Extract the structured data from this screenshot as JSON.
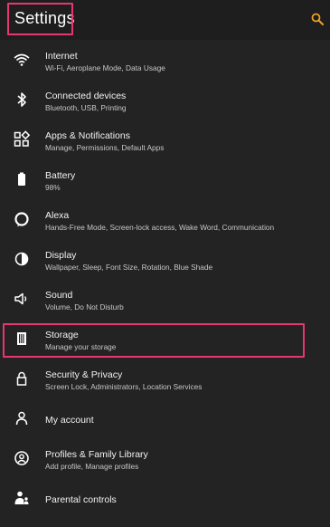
{
  "header": {
    "title": "Settings",
    "search_icon": "search-icon",
    "accent_color": "#f0a024",
    "highlight_color": "#e8366f"
  },
  "settings": [
    {
      "icon": "wifi-icon",
      "label": "Internet",
      "sub": "Wi-Fi, Aeroplane Mode, Data Usage"
    },
    {
      "icon": "bluetooth-icon",
      "label": "Connected devices",
      "sub": "Bluetooth, USB, Printing"
    },
    {
      "icon": "apps-grid-icon",
      "label": "Apps & Notifications",
      "sub": "Manage, Permissions, Default Apps"
    },
    {
      "icon": "battery-icon",
      "label": "Battery",
      "sub": "98%"
    },
    {
      "icon": "alexa-icon",
      "label": "Alexa",
      "sub": "Hands-Free Mode, Screen-lock access, Wake Word, Communication"
    },
    {
      "icon": "display-brightness-icon",
      "label": "Display",
      "sub": "Wallpaper, Sleep, Font Size, Rotation, Blue Shade"
    },
    {
      "icon": "volume-icon",
      "label": "Sound",
      "sub": "Volume, Do Not Disturb"
    },
    {
      "icon": "storage-icon",
      "label": "Storage",
      "sub": "Manage your storage"
    },
    {
      "icon": "lock-icon",
      "label": "Security & Privacy",
      "sub": "Screen Lock, Administrators, Location Services"
    },
    {
      "icon": "account-icon",
      "label": "My account",
      "sub": ""
    },
    {
      "icon": "profiles-icon",
      "label": "Profiles & Family Library",
      "sub": "Add profile, Manage profiles"
    },
    {
      "icon": "parental-controls-icon",
      "label": "Parental controls",
      "sub": ""
    }
  ]
}
